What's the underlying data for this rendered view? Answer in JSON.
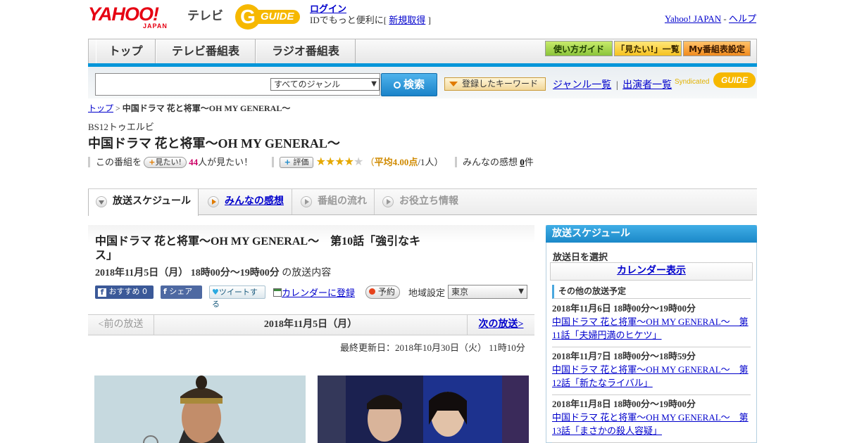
{
  "header": {
    "logo_text": "YAHOO!",
    "logo_sub": "JAPAN",
    "tv_label": "テレビ",
    "gguide_label": "GUIDE",
    "login_label": "ログイン",
    "login_desc_pre": "IDでもっと便利に[",
    "signup_label": "新規取得",
    "login_desc_post": "]",
    "yahoo_japan_link": "Yahoo! JAPAN",
    "separator": "-",
    "help_link": "ヘルプ"
  },
  "nav": {
    "tabs": [
      "トップ",
      "テレビ番組表",
      "ラジオ番組表"
    ],
    "guide_buttons": [
      "使い方ガイド",
      "「見たい!」一覧",
      "My番組表設定"
    ]
  },
  "search": {
    "genre_selected": "すべてのジャンル",
    "search_button": "検索",
    "keyword_button": "登録したキーワード",
    "genre_list_link": "ジャンル一覧",
    "divider": "|",
    "performer_list_link": "出演者一覧",
    "syndicated_label": "Syndicated"
  },
  "breadcrumb": {
    "home": "トップ",
    "sep": ">",
    "current": "中国ドラマ 花と将軍～OH MY GENERAL～"
  },
  "program": {
    "channel": "BS12トゥエルビ",
    "title": "中国ドラマ 花と将軍～OH MY GENERAL～",
    "want_pre": "この番組を",
    "want_button": "見たい!",
    "want_count": "44",
    "want_post": "人が見たい！",
    "rate_button": "評価",
    "rating": 4,
    "rating_open": "（",
    "rating_avg_label": "平均4.00点",
    "rating_post": "/1人）",
    "impressions_pre": "みんなの感想",
    "impressions_count": "0",
    "impressions_unit": "件"
  },
  "section_tabs": [
    "放送スケジュール",
    "みんなの感想",
    "番組の流れ",
    "お役立ち情報"
  ],
  "broadcast": {
    "episode_title": "中国ドラマ 花と将軍～OH MY GENERAL～　第10話「強引なキス」",
    "datetime": "2018年11月5日（月）  18時00分～19時00分",
    "datetime_suffix": "の放送内容",
    "recommend_label": "おすすめ 0",
    "share_label": "シェア",
    "tweet_label": "ツイートする",
    "calendar_register": "カレンダーに登録",
    "reserve_label": "予約",
    "region_label": "地域設定",
    "region_value": "東京",
    "prev_label": "<前の放送",
    "pager_date": "2018年11月5日（月）",
    "next_label": "次の放送>",
    "updated": "最終更新日：2018年10月30日（火）  11時10分"
  },
  "sidebar": {
    "header": "放送スケジュール",
    "select_day": "放送日を選択",
    "calendar_button": "カレンダー表示",
    "other_schedule": "その他の放送予定",
    "items": [
      {
        "datetime": "2018年11月6日  18時00分～19時00分",
        "title": "中国ドラマ 花と将軍～OH MY GENERAL～　第11話「夫婦円満のヒケツ」"
      },
      {
        "datetime": "2018年11月7日  18時00分～18時59分",
        "title": "中国ドラマ 花と将軍～OH MY GENERAL～　第12話「新たなライバル」"
      },
      {
        "datetime": "2018年11月8日  18時00分～19時00分",
        "title": "中国ドラマ 花と将軍～OH MY GENERAL～　第13話「まさかの殺人容疑」"
      }
    ]
  },
  "colors": {
    "accent_blue": "#0095d9",
    "yahoo_red": "#e60012",
    "gguide_yellow": "#f6b800",
    "link": "#0000cc",
    "want_count_color": "#cc0066",
    "rating_color": "#e5a800"
  }
}
